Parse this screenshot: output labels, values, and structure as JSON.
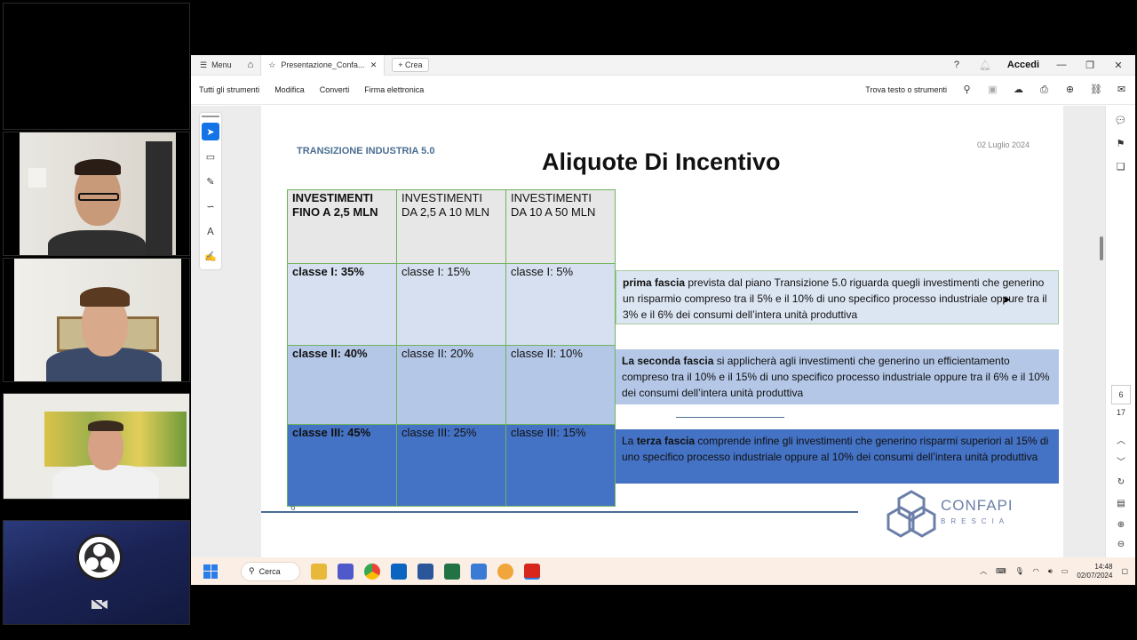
{
  "call": {
    "participants": [
      "participant-1",
      "participant-2",
      "participant-3",
      "participant-4"
    ],
    "obs_icon": "obs-logo-icon",
    "camera_off_icon": "camera-off-icon"
  },
  "browser": {
    "menu_label": "Menu",
    "tab_title": "Presentazione_Confa...",
    "new_tab_label": "Crea",
    "sign_in": "Accedi"
  },
  "toolbar": {
    "items": [
      "Tutti gli strumenti",
      "Modifica",
      "Converti",
      "Firma elettronica"
    ],
    "search_label": "Trova testo o strumenti"
  },
  "viewer": {
    "current_page": "6",
    "total_pages": "17"
  },
  "slide": {
    "header": "TRANSIZIONE INDUSTRIA 5.0",
    "date": "02 Luglio 2024",
    "title": "Aliquote Di Incentivo",
    "table": {
      "headers": [
        "INVESTIMENTI FINO A 2,5 MLN",
        "INVESTIMENTI  DA 2,5 A 10 MLN",
        "INVESTIMENTI DA 10 A 50 MLN"
      ],
      "rows": [
        [
          "classe I: 35%",
          "classe I: 15%",
          "classe I: 5%"
        ],
        [
          "classe II: 40%",
          "classe II: 20%",
          "classe II: 10%"
        ],
        [
          "classe III: 45%",
          "classe III: 25%",
          "classe III: 15%"
        ]
      ]
    },
    "bands": [
      {
        "lead": "prima fascia",
        "text": " prevista dal piano Transizione 5.0 riguarda quegli investimenti che generino un risparmio compreso tra il 5% e il 10% di uno specifico processo industriale oppure tra il 3% e il 6% dei consumi dell’intera unità produttiva",
        "prefix": ""
      },
      {
        "lead": "La seconda fascia",
        "text": " si applicherà agli investimenti che generino un efficientamento compreso tra il 10% e il 15% di uno specifico processo industriale oppure tra il 6% e il 10% dei consumi dell’intera unità produttiva",
        "prefix": ""
      },
      {
        "lead": "terza fascia",
        "text": " comprende infine gli investimenti che generino risparmi superiori al 15% di uno specifico processo industriale oppure al 10% dei consumi dell’intera unità produttiva",
        "prefix": "La "
      }
    ],
    "page_number": "6",
    "logo_name": "CONFAPI",
    "logo_sub": "BRESCIA"
  },
  "taskbar": {
    "search_label": "Cerca",
    "time": "14:48",
    "date": "02/07/2024"
  },
  "colors": {
    "accent": "#1473e6",
    "header_row": "#e7e7e7",
    "class1": "#d6e0f0",
    "class2": "#b4c7e7",
    "class3": "#4472c4",
    "grid_border": "#6fb45d"
  }
}
